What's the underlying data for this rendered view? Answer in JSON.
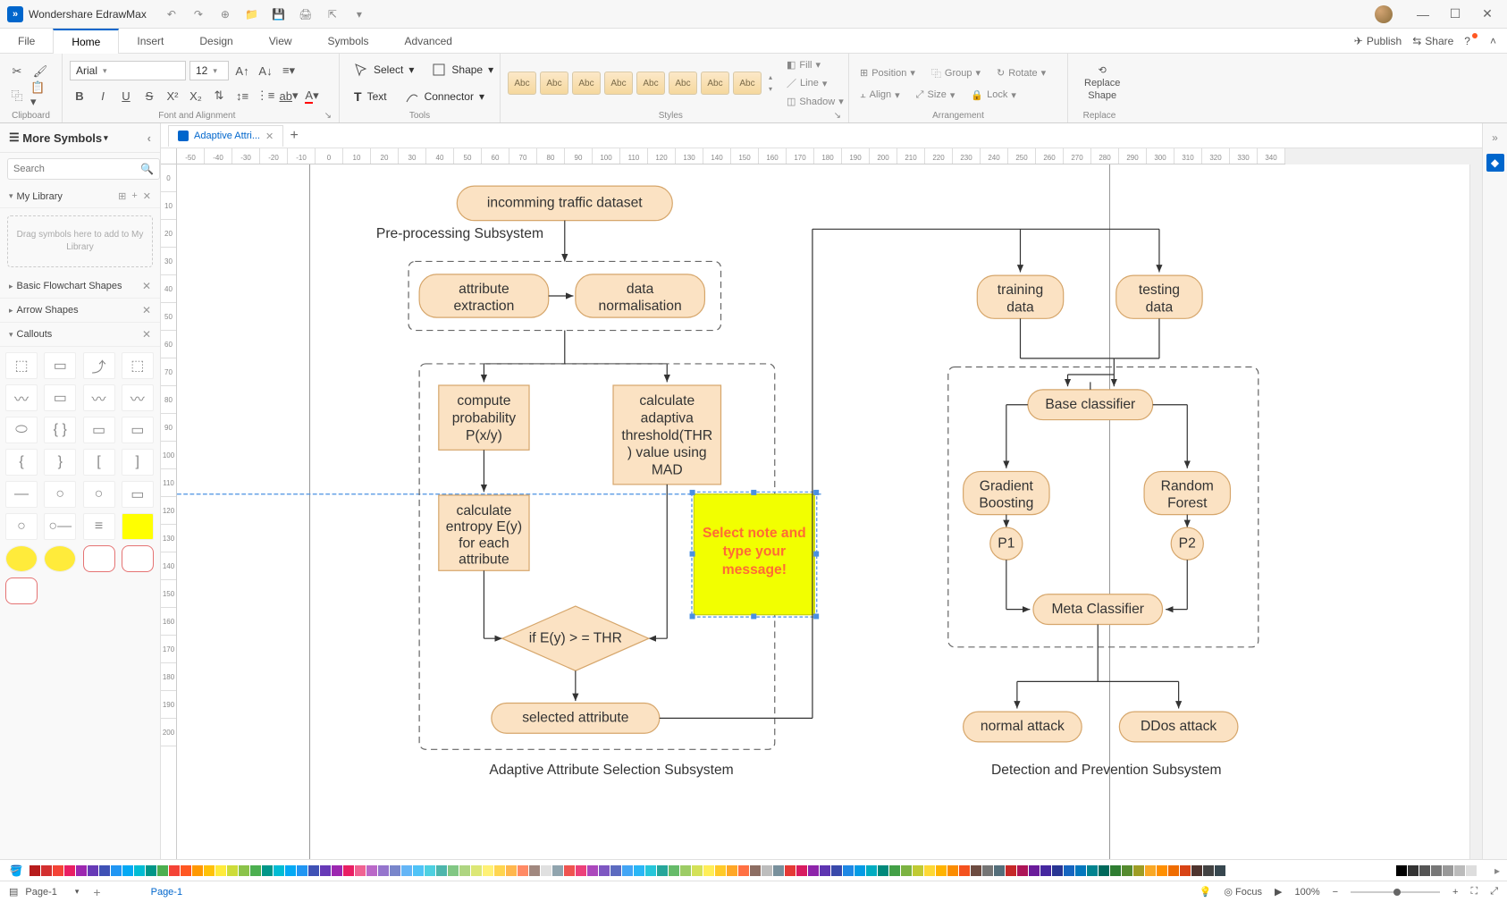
{
  "app": {
    "name": "Wondershare EdrawMax"
  },
  "menu": {
    "tabs": [
      "File",
      "Home",
      "Insert",
      "Design",
      "View",
      "Symbols",
      "Advanced"
    ],
    "active": "Home",
    "publish": "Publish",
    "share": "Share"
  },
  "ribbon": {
    "clipboard": {
      "label": "Clipboard"
    },
    "font": {
      "family": "Arial",
      "size": "12",
      "label": "Font and Alignment"
    },
    "tools": {
      "select": "Select",
      "shape": "Shape",
      "text": "Text",
      "connector": "Connector",
      "label": "Tools"
    },
    "styles": {
      "swatch": "Abc",
      "label": "Styles",
      "fill": "Fill",
      "line": "Line",
      "shadow": "Shadow"
    },
    "arrangement": {
      "position": "Position",
      "group": "Group",
      "rotate": "Rotate",
      "align": "Align",
      "size": "Size",
      "lock": "Lock",
      "label": "Arrangement"
    },
    "replace": {
      "btn": "Replace\nShape",
      "label": "Replace"
    }
  },
  "left": {
    "header": "More Symbols",
    "search_placeholder": "Search",
    "mylib": "My Library",
    "dropzone": "Drag symbols here to add to My Library",
    "sections": {
      "basic": "Basic Flowchart Shapes",
      "arrow": "Arrow Shapes",
      "callouts": "Callouts"
    }
  },
  "doc": {
    "tab_name": "Adaptive Attri..."
  },
  "ruler_h": [
    "-50",
    "-40",
    "-30",
    "-20",
    "-10",
    "0",
    "10",
    "20",
    "30",
    "40",
    "50",
    "60",
    "70",
    "80",
    "90",
    "100",
    "110",
    "120",
    "130",
    "140",
    "150",
    "160",
    "170",
    "180",
    "190",
    "200",
    "210",
    "220",
    "230",
    "240",
    "250",
    "260",
    "270",
    "280",
    "290",
    "300",
    "310",
    "320",
    "330",
    "340"
  ],
  "ruler_v": [
    "0",
    "10",
    "20",
    "30",
    "40",
    "50",
    "60",
    "70",
    "80",
    "90",
    "100",
    "110",
    "120",
    "130",
    "140",
    "150",
    "160",
    "170",
    "180",
    "190",
    "200"
  ],
  "flow": {
    "n_incoming": "incomming traffic dataset",
    "label_preproc": "Pre-processing Subsystem",
    "n_attr_ext1": "attribute",
    "n_attr_ext2": "extraction",
    "n_data_norm1": "data",
    "n_data_norm2": "normalisation",
    "n_compute1": "compute",
    "n_compute2": "probability",
    "n_compute3": "P(x/y)",
    "n_calc_thr1": "calculate",
    "n_calc_thr2": "adaptiva",
    "n_calc_thr3": "threshold(THR",
    "n_calc_thr4": ") value using",
    "n_calc_thr5": "MAD",
    "n_entropy1": "calculate",
    "n_entropy2": "entropy E(y)",
    "n_entropy3": "for each",
    "n_entropy4": "attribute",
    "n_decision": "if E(y) > = THR",
    "n_selected": "selected attribute",
    "label_adaptive": "Adaptive Attribute Selection Subsystem",
    "note1": "Select note and",
    "note2": "type your",
    "note3": "message!",
    "n_training1": "training",
    "n_training2": "data",
    "n_testing1": "testing",
    "n_testing2": "data",
    "n_base": "Base classifier",
    "n_gb1": "Gradient",
    "n_gb2": "Boosting",
    "n_rf1": "Random",
    "n_rf2": "Forest",
    "n_p1": "P1",
    "n_p2": "P2",
    "n_meta": "Meta Classifier",
    "n_normal": "normal attack",
    "n_ddos": "DDos attack",
    "label_detect": "Detection and Prevention Subsystem"
  },
  "status": {
    "page_dd": "Page-1",
    "page_active": "Page-1",
    "focus": "Focus",
    "zoom": "100%"
  },
  "colors": {
    "row1": [
      "#b71c1c",
      "#d32f2f",
      "#f44336",
      "#e91e63",
      "#9c27b0",
      "#673ab7",
      "#3f51b5",
      "#2196f3",
      "#03a9f4",
      "#00bcd4",
      "#009688",
      "#4caf50"
    ],
    "row2": [
      "#f44336",
      "#ff5722",
      "#ff9800",
      "#ffc107",
      "#ffeb3b",
      "#cddc39",
      "#8bc34a",
      "#4caf50",
      "#009688",
      "#00bcd4",
      "#03a9f4",
      "#2196f3",
      "#3f51b5",
      "#673ab7",
      "#9c27b0",
      "#e91e63",
      "#f06292",
      "#ba68c8",
      "#9575cd",
      "#7986cb",
      "#64b5f6",
      "#4fc3f7",
      "#4dd0e1",
      "#4db6ac",
      "#81c784",
      "#aed581",
      "#dce775",
      "#fff176",
      "#ffd54f",
      "#ffb74d",
      "#ff8a65",
      "#a1887f",
      "#e0e0e0",
      "#90a4ae",
      "#ef5350",
      "#ec407a",
      "#ab47bc",
      "#7e57c2",
      "#5c6bc0",
      "#42a5f5",
      "#29b6f6",
      "#26c6da",
      "#26a69a",
      "#66bb6a",
      "#9ccc65",
      "#d4e157",
      "#ffee58",
      "#ffca28",
      "#ffa726",
      "#ff7043",
      "#8d6e63",
      "#bdbdbd",
      "#78909c",
      "#e53935",
      "#d81b60",
      "#8e24aa",
      "#5e35b1",
      "#3949ab",
      "#1e88e5",
      "#039be5",
      "#00acc1",
      "#00897b",
      "#43a047",
      "#7cb342",
      "#c0ca33",
      "#fdd835",
      "#ffb300",
      "#fb8c00",
      "#f4511e",
      "#6d4c41",
      "#757575",
      "#546e7a",
      "#c62828",
      "#ad1457",
      "#6a1b9a",
      "#4527a0",
      "#283593",
      "#1565c0",
      "#0277bd",
      "#00838f",
      "#00695c",
      "#2e7d32",
      "#558b2f",
      "#9e9d24",
      "#f9a825",
      "#ff8f00",
      "#ef6c00",
      "#d84315",
      "#4e342e",
      "#424242",
      "#37474f"
    ],
    "grays": [
      "#000000",
      "#333333",
      "#555555",
      "#777777",
      "#999999",
      "#bbbbbb",
      "#dddddd",
      "#ffffff"
    ]
  }
}
